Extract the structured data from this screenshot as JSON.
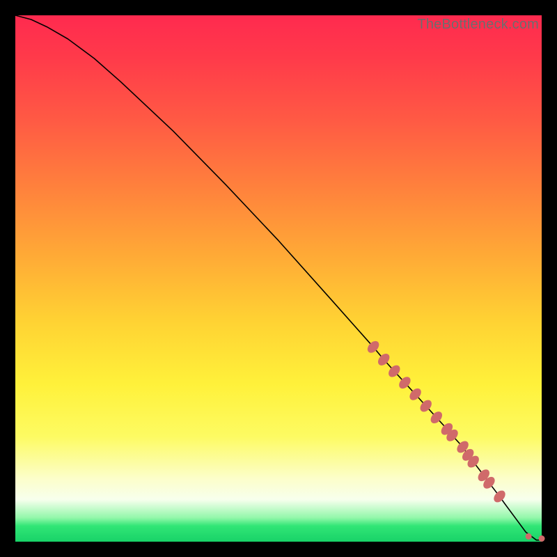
{
  "attribution": "TheBottleneck.com",
  "chart_data": {
    "type": "line",
    "title": "",
    "xlabel": "",
    "ylabel": "",
    "xlim": [
      0,
      100
    ],
    "ylim": [
      0,
      100
    ],
    "grid": false,
    "legend": false,
    "series": [
      {
        "name": "curve",
        "x": [
          0,
          3,
          6,
          10,
          15,
          20,
          30,
          40,
          50,
          60,
          68,
          70,
          72,
          74,
          76,
          78,
          80,
          82,
          83,
          85,
          86,
          87,
          89,
          90,
          92,
          93,
          95,
          97,
          99,
          100
        ],
        "y": [
          100,
          99.2,
          97.8,
          95.5,
          91.8,
          87.4,
          78.0,
          67.8,
          57.2,
          46.0,
          37.0,
          34.6,
          32.4,
          30.2,
          28.0,
          25.8,
          23.6,
          21.4,
          20.2,
          18.0,
          16.5,
          15.2,
          12.6,
          11.2,
          8.6,
          7.2,
          4.5,
          1.8,
          0.3,
          0.3
        ]
      }
    ],
    "points": {
      "name": "markers",
      "comment": "Pink elongated markers along lower-right portion of curve, plus two near bottom-right end",
      "x": [
        68,
        70,
        72,
        74,
        76,
        78,
        80,
        82,
        83,
        85,
        86,
        87,
        89,
        90,
        92,
        97.5,
        100
      ],
      "y": [
        37.0,
        34.6,
        32.4,
        30.2,
        28.0,
        25.8,
        23.6,
        21.4,
        20.2,
        18.0,
        16.5,
        15.2,
        12.6,
        11.2,
        8.6,
        1.0,
        0.6
      ],
      "radius_small": 4.5,
      "radius_large": 6.5
    },
    "colors": {
      "marker": "#d06a6a",
      "line": "#000000",
      "gradient_top": "#ff2a4f",
      "gradient_mid": "#fff13a",
      "gradient_bottom": "#18d268"
    }
  }
}
